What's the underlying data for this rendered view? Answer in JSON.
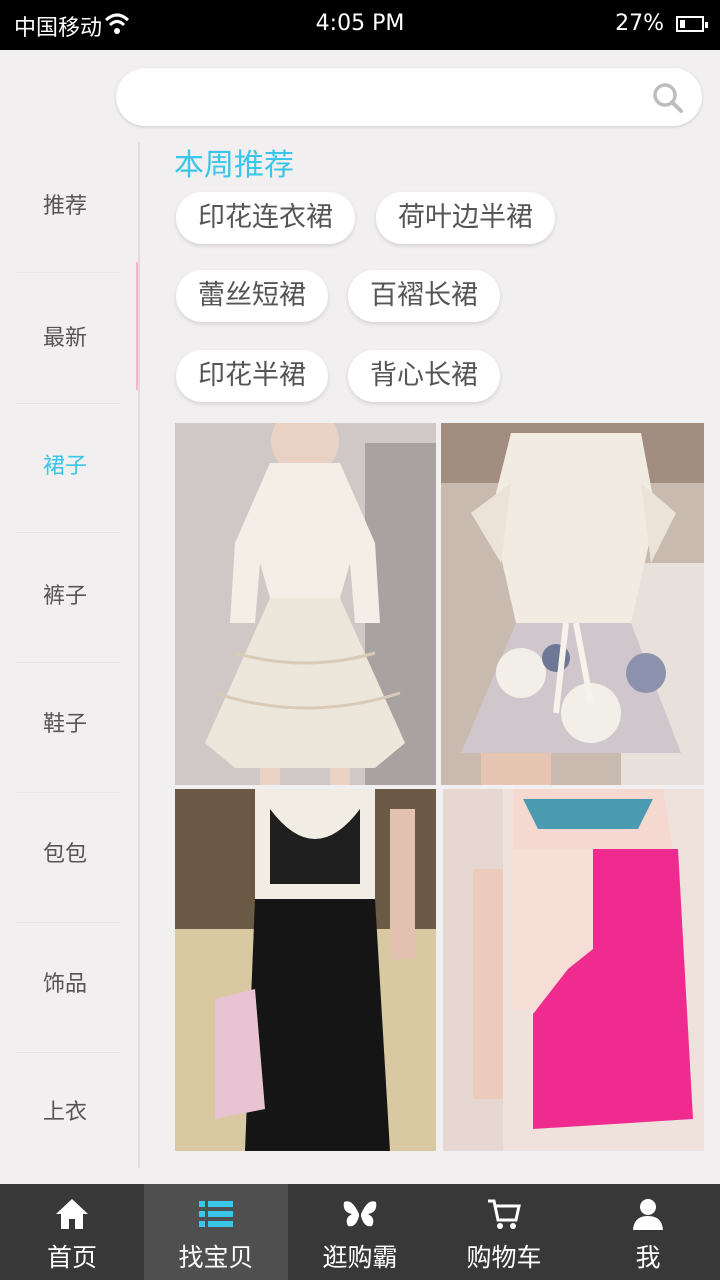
{
  "status_bar": {
    "carrier": "中国移动",
    "time": "4:05 PM",
    "battery": "27%",
    "battery_level": 0.27
  },
  "search": {
    "placeholder": "",
    "icon": "search-icon"
  },
  "sidebar": {
    "items": [
      {
        "label": "推荐"
      },
      {
        "label": "最新"
      },
      {
        "label": "裙子",
        "active": true
      },
      {
        "label": "裤子"
      },
      {
        "label": "鞋子"
      },
      {
        "label": "包包"
      },
      {
        "label": "饰品"
      },
      {
        "label": "上衣"
      }
    ]
  },
  "main": {
    "section_title": "本周推荐",
    "tags": [
      "印花连衣裙",
      "荷叶边半裙",
      "蕾丝短裙",
      "百褶长裙",
      "印花半裙",
      "背心长裙"
    ],
    "products": [
      {
        "name": "white-lace-dress"
      },
      {
        "name": "floral-print-dress"
      },
      {
        "name": "black-maxi-dress"
      },
      {
        "name": "pink-shift-dress"
      }
    ]
  },
  "bottom_nav": {
    "items": [
      {
        "label": "首页",
        "icon": "home-icon"
      },
      {
        "label": "找宝贝",
        "icon": "list-icon",
        "active": true
      },
      {
        "label": "逛购霸",
        "icon": "butterfly-icon"
      },
      {
        "label": "购物车",
        "icon": "cart-icon"
      },
      {
        "label": "我",
        "icon": "user-icon"
      }
    ]
  },
  "colors": {
    "accent": "#3bc5e8",
    "nav_bg": "#383838",
    "nav_active": "#4f4f4f",
    "background": "#f2eff0"
  }
}
